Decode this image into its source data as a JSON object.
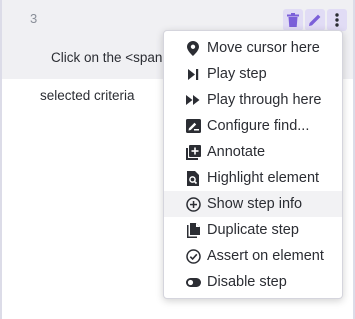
{
  "step": {
    "number": "3",
    "text_line1": "Click on the <span> element that meets th",
    "text_line2": "selected criteria"
  },
  "colors": {
    "accent": "#7b5fd9",
    "row_bg": "#f0f0f3",
    "text": "#2b2d33"
  },
  "menu": {
    "items": [
      {
        "label": "Move cursor here",
        "icon": "map-pin-icon"
      },
      {
        "label": "Play step",
        "icon": "play-step-icon"
      },
      {
        "label": "Play through here",
        "icon": "fast-forward-icon"
      },
      {
        "label": "Configure find...",
        "icon": "configure-find-icon"
      },
      {
        "label": "Annotate",
        "icon": "annotate-icon"
      },
      {
        "label": "Highlight element",
        "icon": "highlight-icon"
      },
      {
        "label": "Show step info",
        "icon": "plus-circle-icon"
      },
      {
        "label": "Duplicate step",
        "icon": "duplicate-icon"
      },
      {
        "label": "Assert on element",
        "icon": "check-circle-icon"
      },
      {
        "label": "Disable step",
        "icon": "toggle-icon"
      }
    ]
  }
}
